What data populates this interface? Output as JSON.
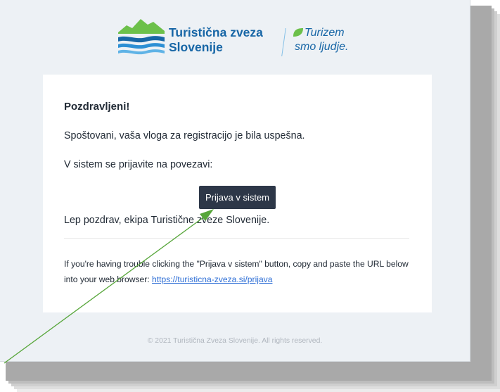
{
  "brand": {
    "name_line1": "Turistična zveza",
    "name_line2": "Slovenije",
    "slogan_line1": "Turizem",
    "slogan_line2": "smo ljudje."
  },
  "email": {
    "greeting": "Pozdravljeni!",
    "paragraph1": "Spoštovani, vaša vloga za registracijo je bila uspešna.",
    "paragraph2": "V sistem se prijavite na povezavi:",
    "button_label": "Prijava v sistem",
    "closing": "Lep pozdrav, ekipa Turistične zveze Slovenije.",
    "trouble_text": "If you're having trouble clicking the \"Prijava v sistem\" button, copy and paste the URL below into your web browser:",
    "trouble_link": "https://turisticna-zveza.si/prijava"
  },
  "footer": {
    "copyright": "© 2021 Turistična Zveza Slovenije. All rights reserved."
  },
  "colors": {
    "brand_blue": "#1766a6",
    "brand_green": "#6cc04a",
    "button_dark": "#2d3748",
    "link_blue": "#2f6fd6",
    "annotation_arrow": "#57a63a"
  },
  "icons": [
    "mountains-logo-icon",
    "leaf-icon",
    "annotation-arrow"
  ]
}
